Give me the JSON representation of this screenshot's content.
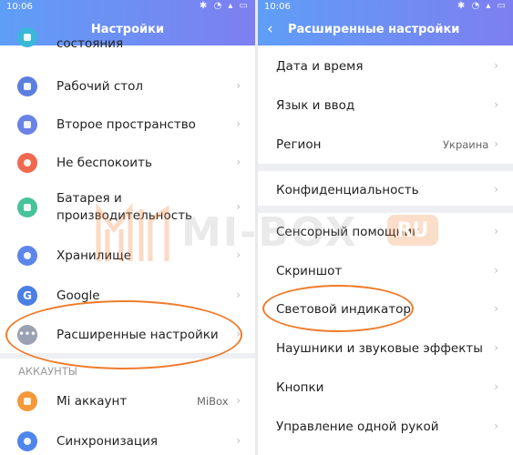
{
  "left": {
    "status": {
      "time": "10:06",
      "icons": "✱ ◔ ▴ ▭"
    },
    "title": "Настройки",
    "items": [
      {
        "label": "состояния",
        "icon": "status-icon",
        "color": "#39b8d9"
      },
      {
        "label": "Рабочий стол",
        "icon": "home-icon",
        "color": "#5b7fe0"
      },
      {
        "label": "Второе пространство",
        "icon": "second-space-icon",
        "color": "#6a82e6"
      },
      {
        "label": "Не беспокоить",
        "icon": "dnd-icon",
        "color": "#f0684f"
      },
      {
        "label": "Батарея и",
        "label2": "производительность",
        "icon": "battery-icon",
        "color": "#46c39a"
      },
      {
        "label": "Хранилище",
        "icon": "storage-icon",
        "color": "#5d86ea"
      },
      {
        "label": "Google",
        "icon": "google-icon",
        "color": "#4a7fe3"
      },
      {
        "label": "Расширенные настройки",
        "icon": "more-icon",
        "color": "#9aa1b2"
      }
    ],
    "section": "АККАУНТЫ",
    "accounts": [
      {
        "label": "Mi аккаунт",
        "value": "MiBox",
        "icon": "mi-account-icon",
        "color": "#f4983a"
      },
      {
        "label": "Синхронизация",
        "icon": "sync-icon",
        "color": "#4f86ec"
      }
    ]
  },
  "right": {
    "status": {
      "time": "10:06",
      "icons": "✱ ◔ ▴ ▭"
    },
    "title": "Расширенные настройки",
    "group1": [
      {
        "label": "Дата и время"
      },
      {
        "label": "Язык и ввод"
      },
      {
        "label": "Регион",
        "value": "Украина"
      }
    ],
    "group2": [
      {
        "label": "Конфиденциальность"
      }
    ],
    "group3": [
      {
        "label": "Сенсорный помощник"
      },
      {
        "label": "Скриншот"
      },
      {
        "label": "Световой индикатор"
      },
      {
        "label": "Наушники и звуковые эффекты"
      },
      {
        "label": "Кнопки"
      },
      {
        "label": "Управление одной рукой"
      }
    ]
  },
  "watermark": {
    "text": "MI-BOX",
    "suffix": "RU"
  },
  "colors": {
    "header_start": "#5f9ef7",
    "header_end": "#7d7ff0",
    "highlight": "#ef7b2a"
  }
}
